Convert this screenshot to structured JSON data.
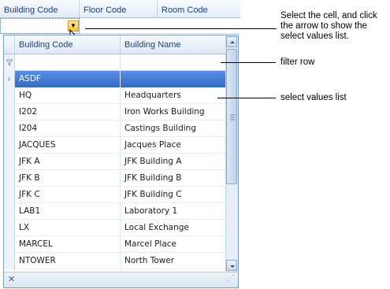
{
  "outer_grid": {
    "columns": [
      "Building Code",
      "Floor Code",
      "Room Code"
    ]
  },
  "popup": {
    "columns": [
      "Building Code",
      "Building Name"
    ],
    "rows": [
      {
        "code": "ASDF",
        "name": "",
        "selected": true
      },
      {
        "code": "HQ",
        "name": "Headquarters"
      },
      {
        "code": "I202",
        "name": "Iron Works Building"
      },
      {
        "code": "I204",
        "name": "Castings Building"
      },
      {
        "code": "JACQUES",
        "name": "Jacques Place"
      },
      {
        "code": "JFK A",
        "name": "JFK Building A"
      },
      {
        "code": "JFK B",
        "name": "JFK Building B"
      },
      {
        "code": "JFK C",
        "name": "JFK Building C"
      },
      {
        "code": "LAB1",
        "name": "Laboratory 1"
      },
      {
        "code": "LX",
        "name": "Local Exchange"
      },
      {
        "code": "MARCEL",
        "name": "Marcel Place"
      },
      {
        "code": "NTOWER",
        "name": "North Tower"
      }
    ],
    "row_indicator": "›",
    "filter_icon": "funnel-icon",
    "close_glyph": "✕",
    "grip_glyph": "⋰"
  },
  "callouts": {
    "select_cell": "Select the cell, and click the arrow to show the select values list.",
    "filter_row": "filter row",
    "select_values_list": "select values list"
  },
  "colors": {
    "selection": "#316ac5",
    "header_text": "#1e3f78",
    "dropdown_button": "#f7c13a"
  }
}
